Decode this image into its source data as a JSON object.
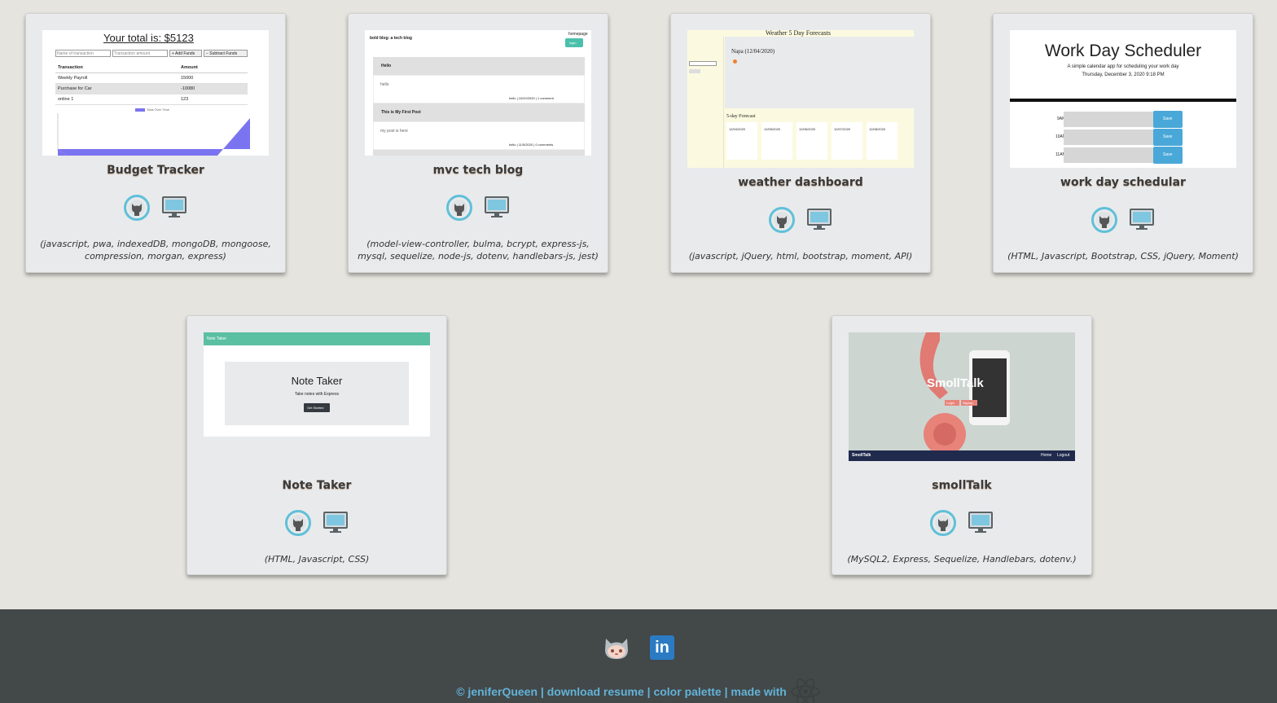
{
  "projects": [
    {
      "title": "Budget Tracker",
      "tech": "(javascript, pwa, indexedDB, mongoDB, mongoose, compression, morgan, express)",
      "preview": {
        "heading": "Your total is: $5123",
        "name_placeholder": "Name of transaction",
        "amount_placeholder": "Transaction amount",
        "add_btn": "+ Add Funds",
        "sub_btn": "− Subtract Funds",
        "columns": [
          "Transaction",
          "Amount"
        ],
        "rows": [
          [
            "Weekly Payroll",
            "15000"
          ],
          [
            "Purchase for Car",
            "-10080"
          ],
          [
            "online 1",
            "123"
          ]
        ],
        "legend": "Total Over Time"
      }
    },
    {
      "title": "mvc tech blog",
      "tech": "(model-view-controller, bulma, bcrypt, express-js, mysql, sequelize, node-js, dotenv, handlebars-js, jest)",
      "preview": {
        "brand": "bold blog: a tech blog",
        "nav_home": "homepage",
        "nav_login": "login",
        "posts": [
          {
            "title": "Hello",
            "body": "hello",
            "meta": "hello | 10/20/2020 | 1 comment"
          },
          {
            "title": "This is My First Post",
            "body": "my post is here",
            "meta": "hello | 11/5/2020 | 0 comments"
          }
        ]
      }
    },
    {
      "title": "weather dashboard",
      "tech": "(javascript, jQuery, html, bootstrap, moment, API)",
      "preview": {
        "heading": "Weather 5 Day Forecasts",
        "city": "Napa (12/04/2020)",
        "forecast_label": "5-day Forecast",
        "days": [
          "12/04/2020",
          "12/05/2020",
          "12/06/2020",
          "12/07/2020",
          "12/08/2020"
        ]
      }
    },
    {
      "title": "work day schedular",
      "tech": "(HTML, Javascript, Bootstrap, CSS, jQuery, Moment)",
      "preview": {
        "heading": "Work Day Scheduler",
        "sub": "A simple calendar app for scheduling your work day",
        "date": "Thursday, December 3, 2020 9:18 PM",
        "hours": [
          "9AM",
          "10AM",
          "11AM"
        ],
        "save": "Save"
      }
    },
    {
      "title": "Note Taker",
      "tech": "(HTML, Javascript, CSS)",
      "preview": {
        "bar": "Note Taker",
        "heading": "Note Taker",
        "sub": "Take notes with Express",
        "btn": "Get Started"
      }
    },
    {
      "title": "smollTalk",
      "tech": "(MySQL2, Express, Sequelize, Handlebars, dotenv.)",
      "preview": {
        "brand": "SmollTalk",
        "login": "Login",
        "signup": "Signup",
        "nav_brand": "SmollTalk",
        "nav_home": "Home",
        "nav_logout": "Logout"
      }
    }
  ],
  "footer": {
    "copyright": "© jeniferQueen",
    "sep": "|",
    "resume": "download resume",
    "palette": "color palette",
    "made_with": "made with"
  },
  "colors": {
    "page_bg": "#e6e4de",
    "card_bg": "#e9eaec",
    "accent": "#5fc0d8",
    "footer_bg": "#434849",
    "footer_text": "#62b3d8"
  },
  "icons": [
    "github-icon",
    "monitor-icon",
    "linkedin-icon",
    "react-icon"
  ]
}
